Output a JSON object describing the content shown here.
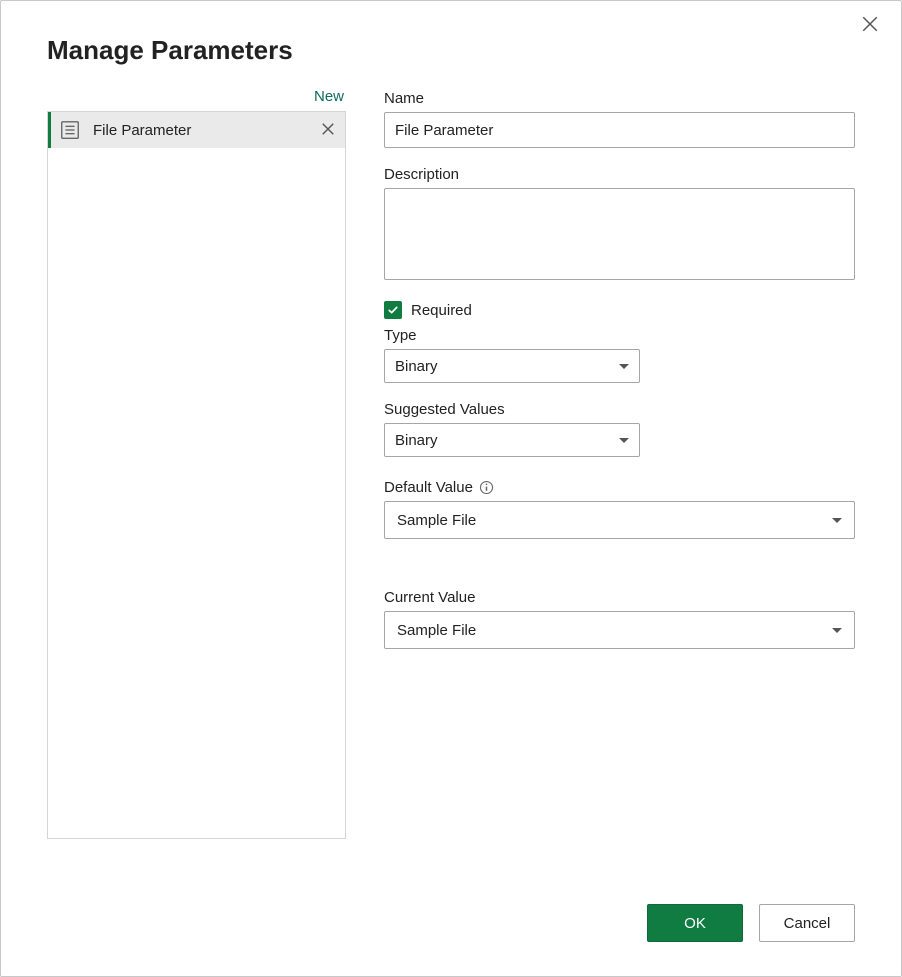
{
  "dialog": {
    "title": "Manage Parameters",
    "new_label": "New",
    "close_label": "Close"
  },
  "param_list": {
    "items": [
      {
        "label": "File Parameter"
      }
    ]
  },
  "form": {
    "name_label": "Name",
    "name_value": "File Parameter",
    "description_label": "Description",
    "description_value": "",
    "required_label": "Required",
    "required_checked": true,
    "type_label": "Type",
    "type_value": "Binary",
    "suggested_label": "Suggested Values",
    "suggested_value": "Binary",
    "default_label": "Default Value",
    "default_value": "Sample File",
    "current_label": "Current Value",
    "current_value": "Sample File"
  },
  "footer": {
    "ok_label": "OK",
    "cancel_label": "Cancel"
  }
}
